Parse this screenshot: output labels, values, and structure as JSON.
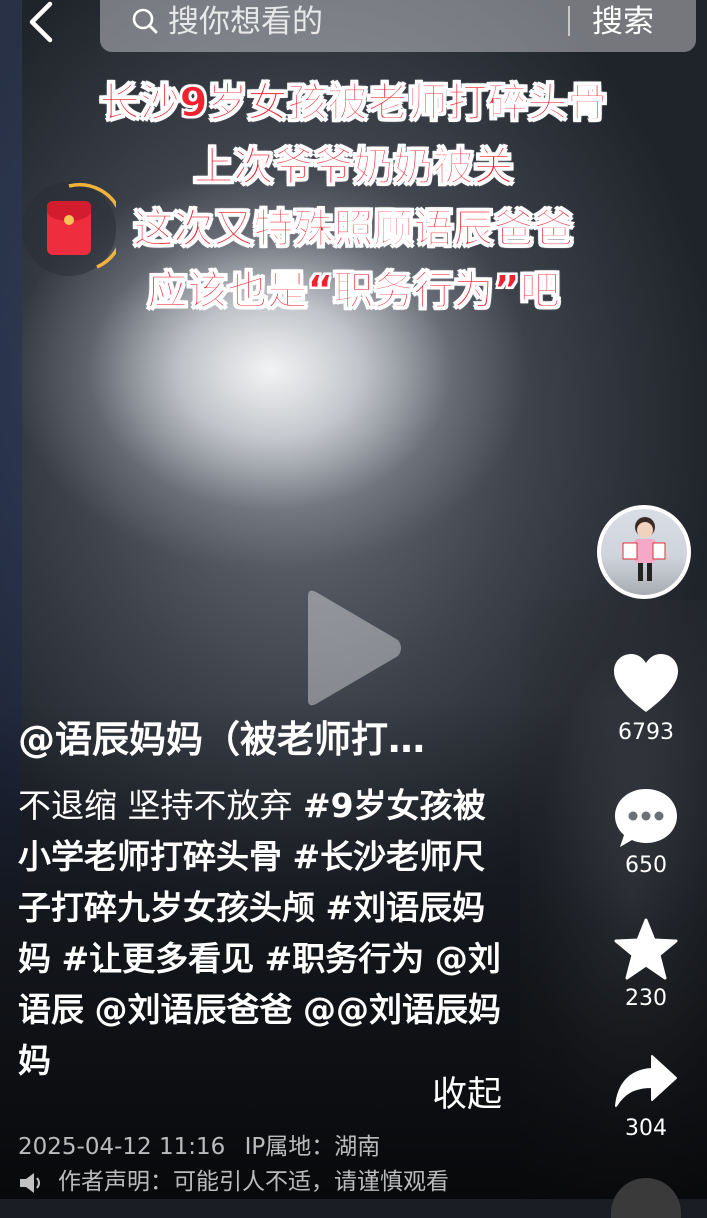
{
  "search": {
    "placeholder": "搜你想看的",
    "button_label": "搜索"
  },
  "overlay_caption": {
    "line1": "长沙9岁女孩被老师打碎头骨",
    "line2": "上次爷爷奶奶被关",
    "line3": "这次又特殊照顾语辰爸爸",
    "line4": "应该也是“职务行为”吧"
  },
  "author": "@语辰妈妈（被老师打…",
  "description": {
    "text": "不退缩 坚持不放弃 ",
    "tags": [
      "#9岁女孩被小学老师打碎头骨",
      "#长沙老师尺子打碎九岁女孩头颅",
      "#刘语辰妈妈",
      "#让更多看见",
      "#职务行为"
    ],
    "mentions": [
      "@刘语辰",
      "@刘语辰爸爸",
      "@@刘语辰妈妈"
    ],
    "collapse_label": "收起"
  },
  "meta": {
    "datetime": "2025-04-12 11:16",
    "ip_label": "IP属地：湖南"
  },
  "notice": "作者声明：可能引人不适，请谨慎观看",
  "actions": {
    "like_count": "6793",
    "comment_count": "650",
    "favorite_count": "230",
    "share_count": "304"
  },
  "colors": {
    "caption_red": "#f0222e",
    "redpacket_red": "#ee2d3e",
    "ring_gold": "#f2b33d"
  },
  "icons": [
    "back-arrow-icon",
    "search-icon",
    "red-packet-icon",
    "play-icon",
    "heart-icon",
    "comment-icon",
    "star-icon",
    "share-icon",
    "speaker-icon"
  ]
}
